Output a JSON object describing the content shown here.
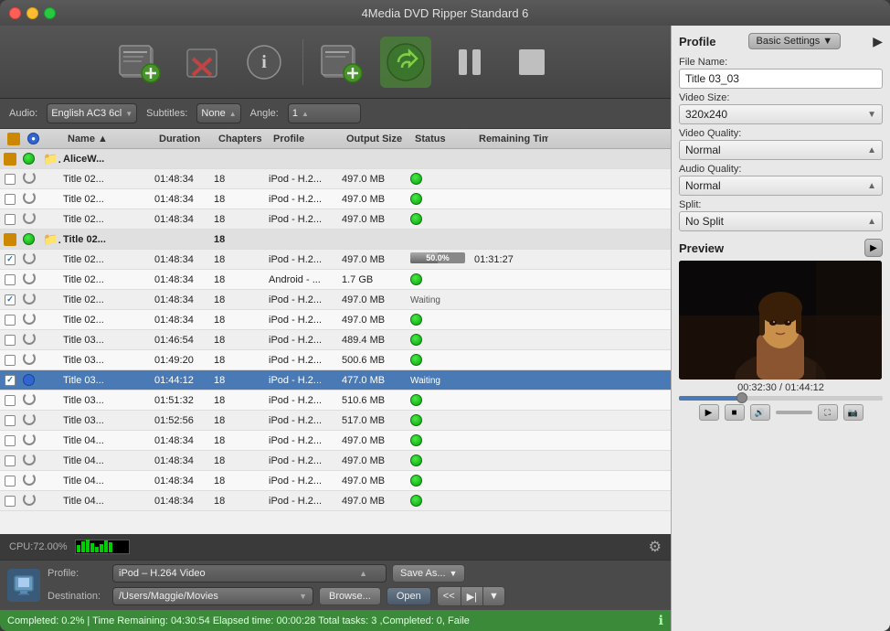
{
  "window": {
    "title": "4Media DVD Ripper Standard 6"
  },
  "toolbar": {
    "add_label": "Add",
    "delete_label": "Delete",
    "info_label": "Info",
    "add_task_label": "Add Task",
    "convert_label": "Convert",
    "pause_label": "Pause",
    "stop_label": "Stop"
  },
  "controls": {
    "audio_label": "Audio:",
    "audio_value": "English AC3 6cl",
    "subtitles_label": "Subtitles:",
    "subtitles_value": "None",
    "angle_label": "Angle:",
    "angle_value": "1"
  },
  "table": {
    "headers": [
      "",
      "",
      "",
      "Name",
      "Duration",
      "Chapters",
      "Profile",
      "Output Size",
      "Status",
      "Remaining Time"
    ],
    "rows": [
      {
        "check": false,
        "status": "orange",
        "icon": "folder",
        "name": "AliceW...",
        "duration": "",
        "chapters": "",
        "profile": "",
        "size": "",
        "status_text": "",
        "remain": "",
        "group": true
      },
      {
        "check": false,
        "status": "spin",
        "icon": "",
        "name": "Title 02...",
        "duration": "01:48:34",
        "chapters": "18",
        "profile": "iPod - H.2...",
        "size": "497.0 MB",
        "status_text": "green",
        "remain": "",
        "group": false
      },
      {
        "check": false,
        "status": "spin",
        "icon": "",
        "name": "Title 02...",
        "duration": "01:48:34",
        "chapters": "18",
        "profile": "iPod - H.2...",
        "size": "497.0 MB",
        "status_text": "green",
        "remain": "",
        "group": false
      },
      {
        "check": false,
        "status": "spin",
        "icon": "",
        "name": "Title 02...",
        "duration": "01:48:34",
        "chapters": "18",
        "profile": "iPod - H.2...",
        "size": "497.0 MB",
        "status_text": "green",
        "remain": "",
        "group": false
      },
      {
        "check": false,
        "status": "orange",
        "icon": "folder",
        "name": "Title 02...",
        "duration": "",
        "chapters": "18",
        "profile": "",
        "size": "",
        "status_text": "",
        "remain": "",
        "group": true
      },
      {
        "check": true,
        "status": "spin",
        "icon": "",
        "name": "Title 02...",
        "duration": "01:48:34",
        "chapters": "18",
        "profile": "iPod - H.2...",
        "size": "497.0 MB",
        "status_text": "progress",
        "remain": "01:31:27",
        "group": false,
        "progress": 0.5
      },
      {
        "check": false,
        "status": "spin",
        "icon": "",
        "name": "Title 02...",
        "duration": "01:48:34",
        "chapters": "18",
        "profile": "Android - ...",
        "size": "1.7 GB",
        "status_text": "green",
        "remain": "",
        "group": false
      },
      {
        "check": true,
        "status": "spin",
        "icon": "",
        "name": "Title 02...",
        "duration": "01:48:34",
        "chapters": "18",
        "profile": "iPod - H.2...",
        "size": "497.0 MB",
        "status_text": "waiting",
        "remain": "",
        "group": false
      },
      {
        "check": false,
        "status": "spin",
        "icon": "",
        "name": "Title 02...",
        "duration": "01:48:34",
        "chapters": "18",
        "profile": "iPod - H.2...",
        "size": "497.0 MB",
        "status_text": "green",
        "remain": "",
        "group": false
      },
      {
        "check": false,
        "status": "spin",
        "icon": "",
        "name": "Title 03...",
        "duration": "01:46:54",
        "chapters": "18",
        "profile": "iPod - H.2...",
        "size": "489.4 MB",
        "status_text": "green",
        "remain": "",
        "group": false
      },
      {
        "check": false,
        "status": "spin",
        "icon": "",
        "name": "Title 03...",
        "duration": "01:49:20",
        "chapters": "18",
        "profile": "iPod - H.2...",
        "size": "500.6 MB",
        "status_text": "green",
        "remain": "",
        "group": false
      },
      {
        "check": true,
        "status": "blue",
        "icon": "",
        "name": "Title 03...",
        "duration": "01:44:12",
        "chapters": "18",
        "profile": "iPod - H.2...",
        "size": "477.0 MB",
        "status_text": "Waiting",
        "remain": "",
        "group": false,
        "selected": true
      },
      {
        "check": false,
        "status": "spin",
        "icon": "",
        "name": "Title 03...",
        "duration": "01:51:32",
        "chapters": "18",
        "profile": "iPod - H.2...",
        "size": "510.6 MB",
        "status_text": "green",
        "remain": "",
        "group": false
      },
      {
        "check": false,
        "status": "spin",
        "icon": "",
        "name": "Title 03...",
        "duration": "01:52:56",
        "chapters": "18",
        "profile": "iPod - H.2...",
        "size": "517.0 MB",
        "status_text": "green",
        "remain": "",
        "group": false
      },
      {
        "check": false,
        "status": "spin",
        "icon": "",
        "name": "Title 04...",
        "duration": "01:48:34",
        "chapters": "18",
        "profile": "iPod - H.2...",
        "size": "497.0 MB",
        "status_text": "green",
        "remain": "",
        "group": false
      },
      {
        "check": false,
        "status": "spin",
        "icon": "",
        "name": "Title 04...",
        "duration": "01:48:34",
        "chapters": "18",
        "profile": "iPod - H.2...",
        "size": "497.0 MB",
        "status_text": "green",
        "remain": "",
        "group": false
      },
      {
        "check": false,
        "status": "spin",
        "icon": "",
        "name": "Title 04...",
        "duration": "01:48:34",
        "chapters": "18",
        "profile": "iPod - H.2...",
        "size": "497.0 MB",
        "status_text": "green",
        "remain": "",
        "group": false
      },
      {
        "check": false,
        "status": "spin",
        "icon": "",
        "name": "Title 04...",
        "duration": "01:48:34",
        "chapters": "18",
        "profile": "iPod - H.2...",
        "size": "497.0 MB",
        "status_text": "green",
        "remain": "",
        "group": false
      }
    ]
  },
  "bottom": {
    "cpu_label": "CPU:72.00%",
    "profile_label": "Profile:",
    "profile_value": "iPod – H.264 Video",
    "save_as_label": "Save As...",
    "destination_label": "Destination:",
    "destination_value": "/Users/Maggie/Movies",
    "browse_label": "Browse...",
    "open_label": "Open"
  },
  "status_bar": {
    "text": "Completed: 0.2% | Time Remaining: 04:30:54 Elapsed time: 00:00:28 Total tasks: 3 ,Completed: 0, Faile"
  },
  "right_panel": {
    "profile_title": "Profile",
    "settings_label": "Basic Settings",
    "file_name_label": "File Name:",
    "file_name_value": "Title 03_03",
    "video_size_label": "Video Size:",
    "video_size_value": "320x240",
    "video_quality_label": "Video Quality:",
    "video_quality_value": "Normal",
    "audio_quality_label": "Audio Quality:",
    "audio_quality_value": "Normal",
    "split_label": "Split:",
    "split_value": "No Split",
    "preview_title": "Preview",
    "preview_time": "00:32:30 / 01:44:12",
    "preview_progress_pct": 31
  }
}
